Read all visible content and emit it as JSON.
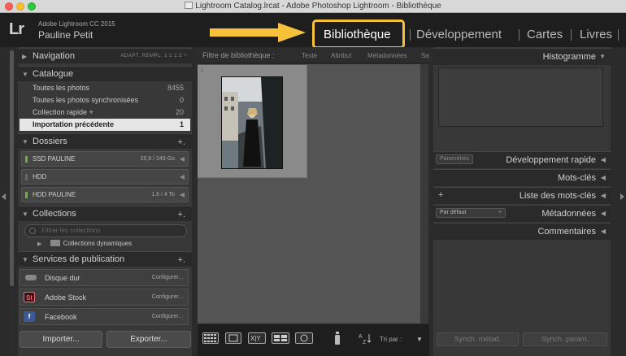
{
  "window": {
    "title": "Lightroom Catalog.lrcat - Adobe Photoshop Lightroom - Bibliothèque"
  },
  "identity": {
    "logo": "Lr",
    "app_name": "Adobe Lightroom CC 2015",
    "user_name": "Pauline Petit"
  },
  "modules": [
    {
      "label": "Bibliothèque",
      "active": true
    },
    {
      "label": "Développement",
      "active": false
    },
    {
      "label": "Cartes",
      "active": false
    },
    {
      "label": "Livres",
      "active": false
    }
  ],
  "left_panel": {
    "navigation": {
      "label": "Navigation",
      "options": "ADAPT.  REMPL.  1:1  1:2 ÷"
    },
    "catalogue": {
      "label": "Catalogue",
      "items": [
        {
          "name": "Toutes les photos",
          "count": "8455"
        },
        {
          "name": "Toutes les photos synchronisées",
          "count": "0"
        },
        {
          "name": "Collection rapide +",
          "count": "20"
        },
        {
          "name": "Importation précédente",
          "count": "1"
        }
      ]
    },
    "dossiers": {
      "label": "Dossiers",
      "add": "+.",
      "items": [
        {
          "name": "SSD PAULINE",
          "size": "20,9 / 249 Go"
        },
        {
          "name": "HDD",
          "size": ""
        },
        {
          "name": "HDD PAULINE",
          "size": "1,6 / 4 To"
        }
      ]
    },
    "collections": {
      "label": "Collections",
      "add": "+.",
      "filter_placeholder": "Filtrer les collections",
      "smart": "Collections dynamiques"
    },
    "publication": {
      "label": "Services de publication",
      "add": "+.",
      "items": [
        {
          "name": "Disque dur",
          "configure": "Configurer..."
        },
        {
          "name": "Adobe Stock",
          "configure": "Configurer...",
          "icon": "St"
        },
        {
          "name": "Facebook",
          "configure": "Configurer...",
          "icon": "f"
        }
      ]
    },
    "buttons": {
      "import": "Importer...",
      "export": "Exporter..."
    }
  },
  "center": {
    "filter_label": "Filtre de bibliothèque :",
    "filter_options": [
      "Texte",
      "Attribut",
      "Métadonnées",
      "Sa"
    ],
    "cell_badge": "1",
    "sort_label": "Tri par :"
  },
  "right_panel": {
    "histogram": "Histogramme",
    "quick_develop": {
      "label": "Développement rapide",
      "preset": "Paramètres"
    },
    "keywording": "Mots-clés",
    "keyword_list": {
      "label": "Liste des mots-clés",
      "add": "+"
    },
    "metadata": {
      "label": "Métadonnées",
      "preset": "Par défaut"
    },
    "comments": "Commentaires",
    "sync_metadata": "Synch. métad.",
    "sync_settings": "Synch. param."
  },
  "colors": {
    "highlight": "#f7c23a",
    "folder_online": "#6fae3e",
    "adobe_stock": "#3b0f12",
    "facebook": "#3b5998"
  }
}
